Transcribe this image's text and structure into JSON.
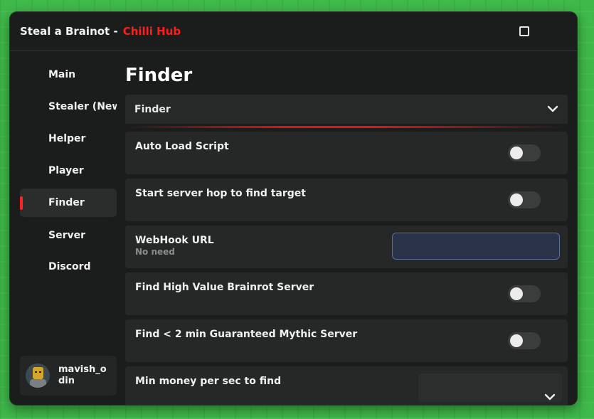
{
  "window": {
    "title": "Steal a Brainot -",
    "title_accent": "Chilli Hub",
    "accent_color": "#ff1e1e"
  },
  "sidebar": {
    "items": [
      {
        "label": "Main",
        "active": false
      },
      {
        "label": "Stealer (New",
        "active": false
      },
      {
        "label": "Helper",
        "active": false
      },
      {
        "label": "Player",
        "active": false
      },
      {
        "label": "Finder",
        "active": true
      },
      {
        "label": "Server",
        "active": false
      },
      {
        "label": "Discord",
        "active": false
      }
    ],
    "profile": {
      "username": "mavish_odin"
    }
  },
  "main": {
    "page_title": "Finder",
    "section_dropdown": {
      "label": "Finder",
      "icon": "chevron-down-icon"
    },
    "rows": [
      {
        "label": "Auto Load Script",
        "type": "toggle",
        "on": false
      },
      {
        "label": "Start server hop to find target",
        "type": "toggle",
        "on": false
      },
      {
        "label": "WebHook URL",
        "sublabel": "No need",
        "type": "input",
        "value": "",
        "placeholder": ""
      },
      {
        "label": "Find High Value Brainrot Server",
        "type": "toggle",
        "on": false
      },
      {
        "label": "Find < 2 min Guaranteed Mythic Server",
        "type": "toggle",
        "on": false
      },
      {
        "label": "Min money per sec to find",
        "type": "dropdown",
        "value": ""
      }
    ]
  }
}
